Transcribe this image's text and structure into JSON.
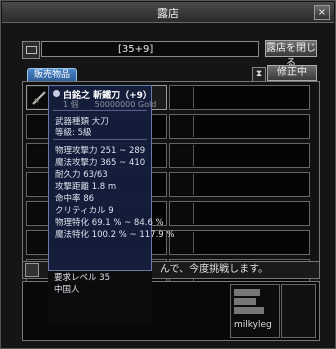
{
  "window": {
    "title": "露店",
    "close_label": "×"
  },
  "shop": {
    "name_value": "[35+9]",
    "close_shop_button": "露店を閉じる",
    "editing_button": "修正中"
  },
  "tabs": [
    {
      "label": "販売物品"
    }
  ],
  "item_slots": [
    {
      "has_item": true,
      "icon": "sword-icon"
    },
    {
      "has_item": false
    },
    {
      "has_item": false
    },
    {
      "has_item": false
    },
    {
      "has_item": false
    },
    {
      "has_item": false
    },
    {
      "has_item": false
    },
    {
      "has_item": false
    },
    {
      "has_item": false
    },
    {
      "has_item": false
    },
    {
      "has_item": false
    },
    {
      "has_item": false
    },
    {
      "has_item": false
    },
    {
      "has_item": false
    }
  ],
  "tooltip": {
    "title": "白銘之 斬鐵刀（+9）",
    "subtitle": "1 個　　50000000 Gold",
    "lines_top": [
      "武器種類 大刀",
      "等級: 5級"
    ],
    "lines_stats": [
      "物理攻撃力 251 ~ 289",
      "魔法攻撃力 365 ~ 410",
      "耐久力 63/63",
      "攻撃距離 1.8 m",
      "命中率 86",
      "クリティカル 9",
      "物理特化 69.1 % ~ 84.6 %",
      "魔法特化 100.2 % ~ 117.9 %"
    ],
    "lines_req": [
      "要求レベル 35",
      "中国人"
    ]
  },
  "notice": {
    "text": "んで、今度挑戦します。"
  },
  "chat_log": {
    "name": "milkyleg"
  }
}
